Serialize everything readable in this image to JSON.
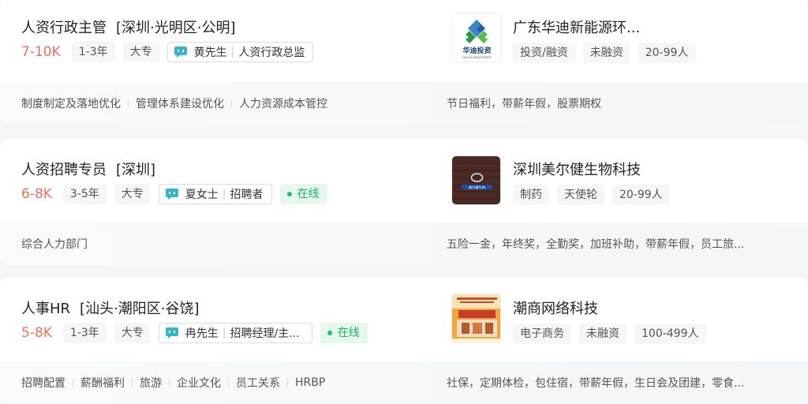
{
  "jobs": [
    {
      "title": "人资行政主管",
      "area": "[深圳·光明区·公明]",
      "salary": "7-10K",
      "experience": "1-3年",
      "degree": "大专",
      "recruiter_name": "黄先生",
      "recruiter_title": "人资行政总监",
      "online": "",
      "skills": [
        "制度制定及落地优化",
        "管理体系建设优化",
        "人力资源成本管控"
      ],
      "company": "广东华迪新能源环...",
      "company_tags": [
        "投资/融资",
        "未融资",
        "20-99人"
      ],
      "welfare": "节日福利，带薪年假，股票期权",
      "logo_text": "华迪投资",
      "logo_sub": "HUA DI INVESTMENT"
    },
    {
      "title": "人资招聘专员",
      "area": "[深圳]",
      "salary": "6-8K",
      "experience": "3-5年",
      "degree": "大专",
      "recruiter_name": "夏女士",
      "recruiter_title": "招聘者",
      "online": "在线",
      "skills": [
        "综合人力部门"
      ],
      "company": "深圳美尔健生物科技",
      "company_tags": [
        "制药",
        "天使轮",
        "20-99人"
      ],
      "welfare": "五险一金，年终奖，全勤奖，加班补助，带薪年假，员工旅...",
      "logo_text": "美尔健生物"
    },
    {
      "title": "人事HR",
      "area": "[汕头·潮阳区·谷饶]",
      "salary": "5-8K",
      "experience": "1-3年",
      "degree": "大专",
      "recruiter_name": "冉先生",
      "recruiter_title": "招聘经理/主...",
      "online": "在线",
      "skills": [
        "招聘配置",
        "薪酬福利",
        "旅游",
        "企业文化",
        "员工关系",
        "HRBP"
      ],
      "company": "潮商网络科技",
      "company_tags": [
        "电子商务",
        "未融资",
        "100-499人"
      ],
      "welfare": "社保，定期体检，包住宿，带薪年假，生日会及团建，零食...",
      "logo_text": ""
    }
  ],
  "colors": {
    "salary": "#f26d5b",
    "online": "#17b363",
    "chat_icon": "#35b6c7"
  }
}
